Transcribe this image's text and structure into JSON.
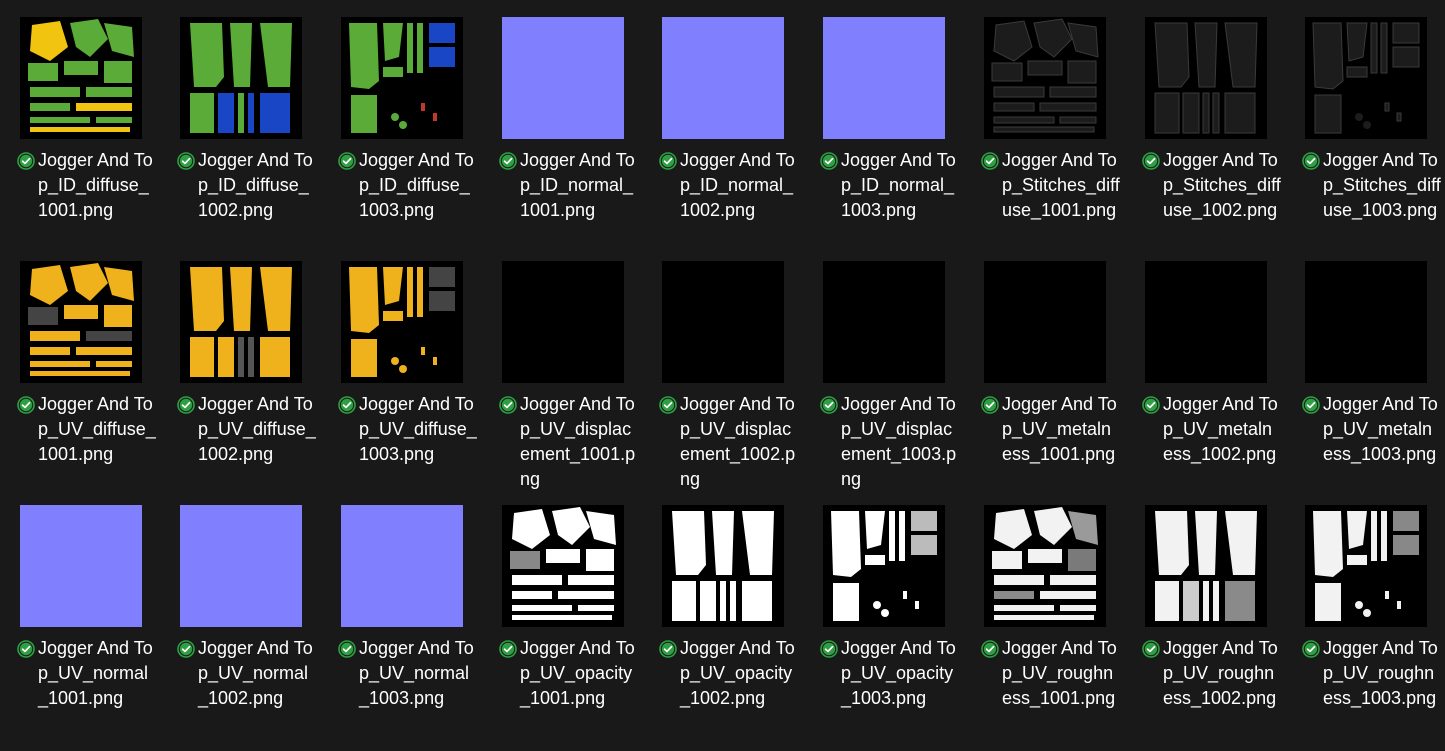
{
  "colors": {
    "background": "#191919",
    "normal_map": "#8080ff",
    "id_green": "#5aab37",
    "id_yellow": "#f1c40f",
    "id_blue": "#1846c4",
    "uv_orange": "#f0b21c",
    "status_green": "#2ea043"
  },
  "files": [
    {
      "name": "Jogger And Top_ID_diffuse_1001.png",
      "kind": "id-diffuse-1",
      "icon": "sync-check-icon"
    },
    {
      "name": "Jogger And Top_ID_diffuse_1002.png",
      "kind": "id-diffuse-2",
      "icon": "sync-check-icon"
    },
    {
      "name": "Jogger And Top_ID_diffuse_1003.png",
      "kind": "id-diffuse-3",
      "icon": "sync-check-icon"
    },
    {
      "name": "Jogger And Top_ID_normal_1001.png",
      "kind": "normal",
      "icon": "sync-check-icon"
    },
    {
      "name": "Jogger And Top_ID_normal_1002.png",
      "kind": "normal",
      "icon": "sync-check-icon"
    },
    {
      "name": "Jogger And Top_ID_normal_1003.png",
      "kind": "normal",
      "icon": "sync-check-icon"
    },
    {
      "name": "Jogger And Top_Stitches_diffuse_1001.png",
      "kind": "stitch-1",
      "icon": "sync-check-icon"
    },
    {
      "name": "Jogger And Top_Stitches_diffuse_1002.png",
      "kind": "stitch-2",
      "icon": "sync-check-icon"
    },
    {
      "name": "Jogger And Top_Stitches_diffuse_1003.png",
      "kind": "stitch-3",
      "icon": "sync-check-icon"
    },
    {
      "name": "Jogger And Top_UV_diffuse_1001.png",
      "kind": "uv-diffuse-1",
      "icon": "sync-check-icon"
    },
    {
      "name": "Jogger And Top_UV_diffuse_1002.png",
      "kind": "uv-diffuse-2",
      "icon": "sync-check-icon"
    },
    {
      "name": "Jogger And Top_UV_diffuse_1003.png",
      "kind": "uv-diffuse-3",
      "icon": "sync-check-icon"
    },
    {
      "name": "Jogger And Top_UV_displacement_1001.png",
      "kind": "black",
      "icon": "sync-check-icon"
    },
    {
      "name": "Jogger And Top_UV_displacement_1002.png",
      "kind": "black",
      "icon": "sync-check-icon"
    },
    {
      "name": "Jogger And Top_UV_displacement_1003.png",
      "kind": "black",
      "icon": "sync-check-icon"
    },
    {
      "name": "Jogger And Top_UV_metalness_1001.png",
      "kind": "black",
      "icon": "sync-check-icon"
    },
    {
      "name": "Jogger And Top_UV_metalness_1002.png",
      "kind": "black",
      "icon": "sync-check-icon"
    },
    {
      "name": "Jogger And Top_UV_metalness_1003.png",
      "kind": "black",
      "icon": "sync-check-icon"
    },
    {
      "name": "Jogger And Top_UV_normal_1001.png",
      "kind": "normal",
      "icon": "sync-check-icon"
    },
    {
      "name": "Jogger And Top_UV_normal_1002.png",
      "kind": "normal",
      "icon": "sync-check-icon"
    },
    {
      "name": "Jogger And Top_UV_normal_1003.png",
      "kind": "normal",
      "icon": "sync-check-icon"
    },
    {
      "name": "Jogger And Top_UV_opacity_1001.png",
      "kind": "mask-1",
      "icon": "sync-check-icon"
    },
    {
      "name": "Jogger And Top_UV_opacity_1002.png",
      "kind": "mask-2",
      "icon": "sync-check-icon"
    },
    {
      "name": "Jogger And Top_UV_opacity_1003.png",
      "kind": "mask-3",
      "icon": "sync-check-icon"
    },
    {
      "name": "Jogger And Top_UV_roughness_1001.png",
      "kind": "rough-1",
      "icon": "sync-check-icon"
    },
    {
      "name": "Jogger And Top_UV_roughness_1002.png",
      "kind": "rough-2",
      "icon": "sync-check-icon"
    },
    {
      "name": "Jogger And Top_UV_roughness_1003.png",
      "kind": "rough-3",
      "icon": "sync-check-icon"
    }
  ]
}
